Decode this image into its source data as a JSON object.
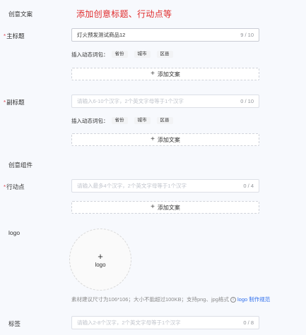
{
  "creative_copy": {
    "title": "创意文案",
    "annotation": "添加创意标题、行动点等"
  },
  "main_title": {
    "label": "主标题",
    "required_mark": "*",
    "value": "灯火预发测试商品12",
    "count": "9 / 10"
  },
  "sub_title": {
    "label": "副标题",
    "required_mark": "*",
    "placeholder": "请输入6-10个汉字，2个英文字母等于1个汉字",
    "count": "0 / 10"
  },
  "dynamic_words": {
    "label": "插入动态词包：",
    "chips": [
      "省份",
      "城市",
      "区县"
    ]
  },
  "add_copy_label": "添加文案",
  "components": {
    "title": "创意组件"
  },
  "action_point": {
    "label": "行动点",
    "required_mark": "*",
    "placeholder": "请输入最多4个汉字，2个英文字母等于1个汉字",
    "count": "0 / 4"
  },
  "logo": {
    "label": "logo",
    "upload_text": "logo",
    "tip": "素材建议尺寸为106*106；大小不能超过100KB；支持png、jpg格式",
    "tip_link": "logo 制作规范"
  },
  "tag": {
    "label": "标签",
    "placeholder": "请输入2-8个汉字，2个英文字母等于1个汉字",
    "count": "0 / 8"
  },
  "icons": {
    "plus": "plus-icon",
    "info": "info-icon"
  }
}
